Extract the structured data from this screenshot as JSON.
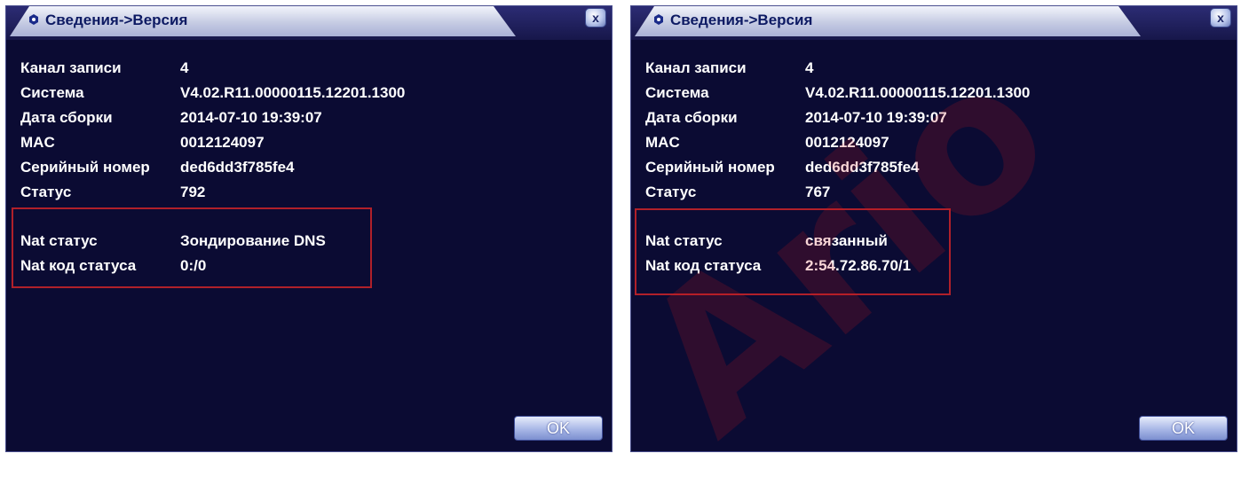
{
  "left": {
    "title": "Сведения->Версия",
    "close": "x",
    "ok": "OK",
    "info": [
      {
        "label": "Канал записи",
        "value": "4"
      },
      {
        "label": "Система",
        "value": "V4.02.R11.00000115.12201.1300"
      },
      {
        "label": "Дата сборки",
        "value": "2014-07-10 19:39:07"
      },
      {
        "label": "MAC",
        "value": "0012124097"
      },
      {
        "label": "Серийный номер",
        "value": "ded6dd3f785fe4"
      },
      {
        "label": "Статус",
        "value": "792"
      }
    ],
    "nat": [
      {
        "label": "Nat статус",
        "value": "Зондирование DNS"
      },
      {
        "label": "Nat код статуса",
        "value": "0:/0"
      }
    ]
  },
  "right": {
    "title": "Сведения->Версия",
    "close": "x",
    "ok": "OK",
    "info": [
      {
        "label": "Канал записи",
        "value": "4"
      },
      {
        "label": "Система",
        "value": "V4.02.R11.00000115.12201.1300"
      },
      {
        "label": "Дата сборки",
        "value": "2014-07-10 19:39:07"
      },
      {
        "label": "MAC",
        "value": "0012124097"
      },
      {
        "label": "Серийный номер",
        "value": "ded6dd3f785fe4"
      },
      {
        "label": "Статус",
        "value": "767"
      }
    ],
    "nat": [
      {
        "label": "Nat статус",
        "value": "связанный"
      },
      {
        "label": "Nat код статуса",
        "value": "2:54.72.86.70/1"
      }
    ]
  },
  "watermark": "Ario"
}
